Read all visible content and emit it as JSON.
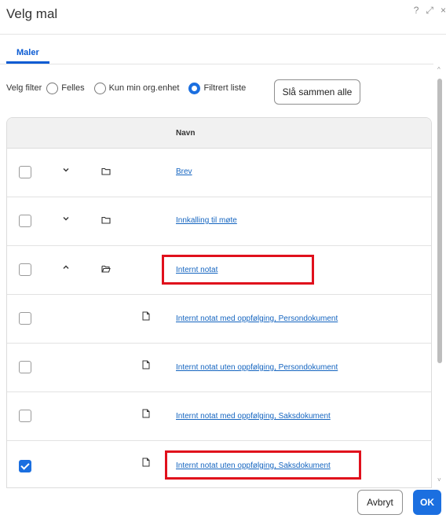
{
  "dialog": {
    "title": "Velg mal",
    "icons": {
      "help": "?",
      "expand": "⤢",
      "close": "×"
    }
  },
  "tabs": [
    {
      "label": "Maler",
      "active": true
    }
  ],
  "filter": {
    "label": "Velg filter",
    "options": [
      {
        "label": "Felles",
        "selected": false
      },
      {
        "label": "Kun min org.enhet",
        "selected": false
      },
      {
        "label": "Filtrert liste",
        "selected": true
      }
    ],
    "merge_button": "Slå sammen alle"
  },
  "table": {
    "header": {
      "name": "Navn"
    },
    "rows": [
      {
        "name": "Brev",
        "type": "folder",
        "expanded": false,
        "checked": false,
        "highlighted": false
      },
      {
        "name": "Innkalling til møte",
        "type": "folder",
        "expanded": false,
        "checked": false,
        "highlighted": false
      },
      {
        "name": "Internt notat",
        "type": "folder",
        "expanded": true,
        "checked": false,
        "highlighted": true
      },
      {
        "name": "Internt notat med oppfølging, Persondokument",
        "type": "document",
        "checked": false,
        "highlighted": false
      },
      {
        "name": "Internt notat uten oppfølging, Persondokument",
        "type": "document",
        "checked": false,
        "highlighted": false
      },
      {
        "name": "Internt notat med oppfølging, Saksdokument",
        "type": "document",
        "checked": false,
        "highlighted": false
      },
      {
        "name": "Internt notat uten oppfølging, Saksdokument",
        "type": "document",
        "checked": true,
        "highlighted": true
      }
    ]
  },
  "footer": {
    "cancel": "Avbryt",
    "ok": "OK"
  },
  "colors": {
    "accent": "#1b6fe0",
    "link": "#1565c0",
    "highlight": "#e0101c"
  }
}
